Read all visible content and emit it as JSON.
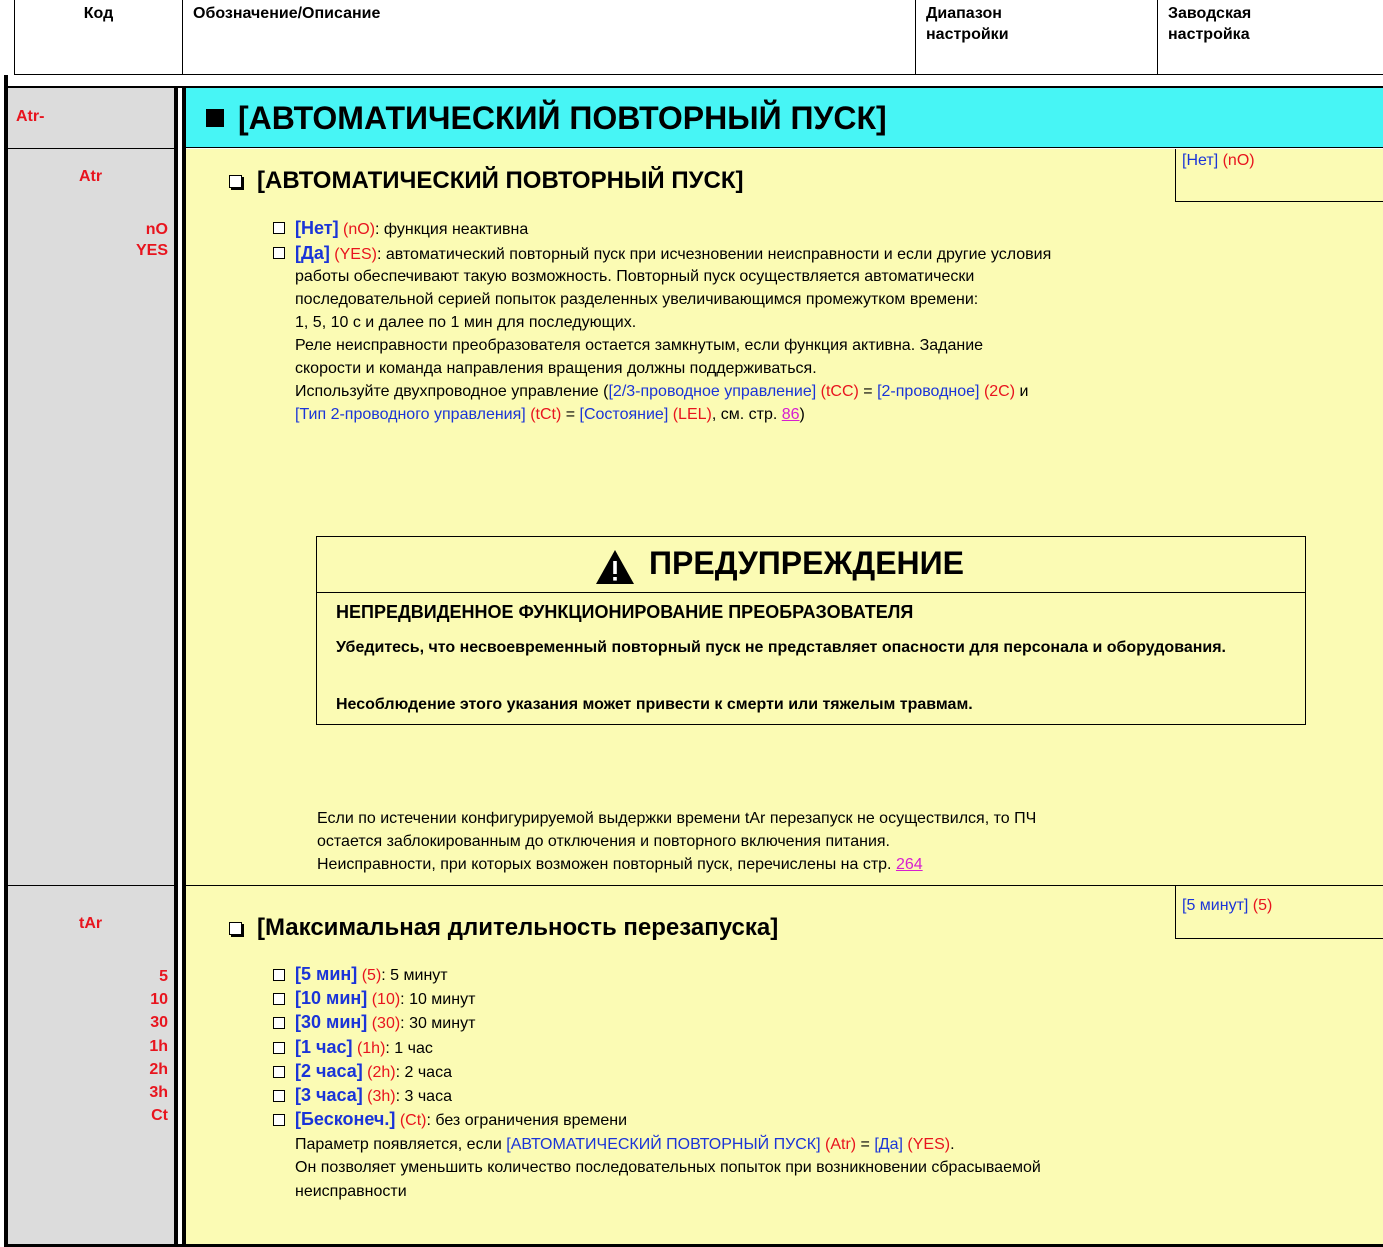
{
  "header": {
    "col_code": "Код",
    "col_desc": "Обозначение/Описание",
    "col_range": "Диапазон настройки",
    "col_factory": "Заводская настройка"
  },
  "menu": {
    "code": "Atr-",
    "title": "[АВТОМАТИЧЕСКИЙ ПОВТОРНЫЙ ПУСК]"
  },
  "param_atr": {
    "code": "Atr",
    "value_codes": [
      "nO",
      "YES"
    ],
    "title": "[АВТОМАТИЧЕСКИЙ ПОВТОРНЫЙ ПУСК]",
    "factory_label": "[Нет]",
    "factory_code": "(nO)",
    "opt_no": {
      "label": "[Нет]",
      "code": "(nO)",
      "text": ": функция неактивна"
    },
    "opt_yes": {
      "label": "[Да]",
      "code": "(YES)",
      "text": ": автоматический повторный пуск при исчезновении неисправности и если другие условия"
    },
    "desc_lines": [
      "работы обеспечивают такую возможность. Повторный пуск осуществляется автоматически",
      "последовательной серией попыток разделенных увеличивающимся промежутком времени:",
      "1, 5, 10 с и далее по 1 мин для последующих.",
      "Реле неисправности преобразователя остается замкнутым, если функция активна. Задание",
      "скорости и команда направления вращения должны поддерживаться."
    ],
    "ref_line1": {
      "p1": "Используйте двухпроводное управление (",
      "b1": "[2/3-проводное управление]",
      "r1": "(tCC)",
      "eq": " = ",
      "b2": "[2-проводное]",
      "r2": "(2C)",
      "end": " и"
    },
    "ref_line2": {
      "b1": "[Тип 2-проводного управления]",
      "r1": "(tCt)",
      "eq": " = ",
      "b2": "[Состояние]",
      "r2": "(LEL)",
      "see": ", см. стр. ",
      "page": "86",
      "close": ")"
    },
    "warning": {
      "title": "ПРЕДУПРЕЖДЕНИЕ",
      "subtitle": "НЕПРЕДВИДЕННОЕ ФУНКЦИОНИРОВАНИЕ ПРЕОБРАЗОВАТЕЛЯ",
      "body1": "Убедитесь, что несвоевременный повторный пуск не представляет опасности для персонала и оборудования.",
      "body2": "Несоблюдение этого указания может привести к смерти или тяжелым травмам."
    },
    "after_lines": [
      "Если по истечении конфигурируемой выдержки времени tAr перезапуск не осуществился, то ПЧ",
      "остается заблокированным до отключения и повторного включения питания."
    ],
    "faults_text": "Неисправности, при которых возможен повторный пуск, перечислены на стр. ",
    "faults_page": "264"
  },
  "param_tar": {
    "code": "tAr",
    "value_codes": [
      "5",
      "10",
      "30",
      "1h",
      "2h",
      "3h",
      "Ct"
    ],
    "title": "[Максимальная длительность перезапуска]",
    "factory_label": "[5 минут]",
    "factory_code": "(5)",
    "options": [
      {
        "label": "[5 мин]",
        "code": "(5)",
        "text": ": 5 минут"
      },
      {
        "label": "[10 мин]",
        "code": "(10)",
        "text": ": 10 минут"
      },
      {
        "label": "[30 мин]",
        "code": "(30)",
        "text": ": 30 минут"
      },
      {
        "label": "[1 час]",
        "code": "(1h)",
        "text": ": 1 час"
      },
      {
        "label": "[2 часа]",
        "code": "(2h)",
        "text": ": 2 часа"
      },
      {
        "label": "[3 часа]",
        "code": "(3h)",
        "text": ": 3 часа"
      },
      {
        "label": "[Бесконеч.]",
        "code": "(Ct)",
        "text": ": без ограничения времени"
      }
    ],
    "note1": {
      "p1": "Параметр появляется, если ",
      "b1": "[АВТОМАТИЧЕСКИЙ ПОВТОРНЫЙ ПУСК]",
      "r1": "(Atr)",
      "eq": " = ",
      "b2": "[Да]",
      "r2": "(YES)",
      "end": "."
    },
    "note2_lines": [
      "Он позволяет уменьшить количество последовательных попыток при возникновении сбрасываемой",
      "неисправности"
    ]
  },
  "colors": {
    "left_bg": "#dcdcdc",
    "menu_bg": "#47f5f5",
    "content_bg": "#fbfbb4",
    "param_code": "#e8141e",
    "param_name": "#1a34d8",
    "link": "#d61ed0"
  }
}
